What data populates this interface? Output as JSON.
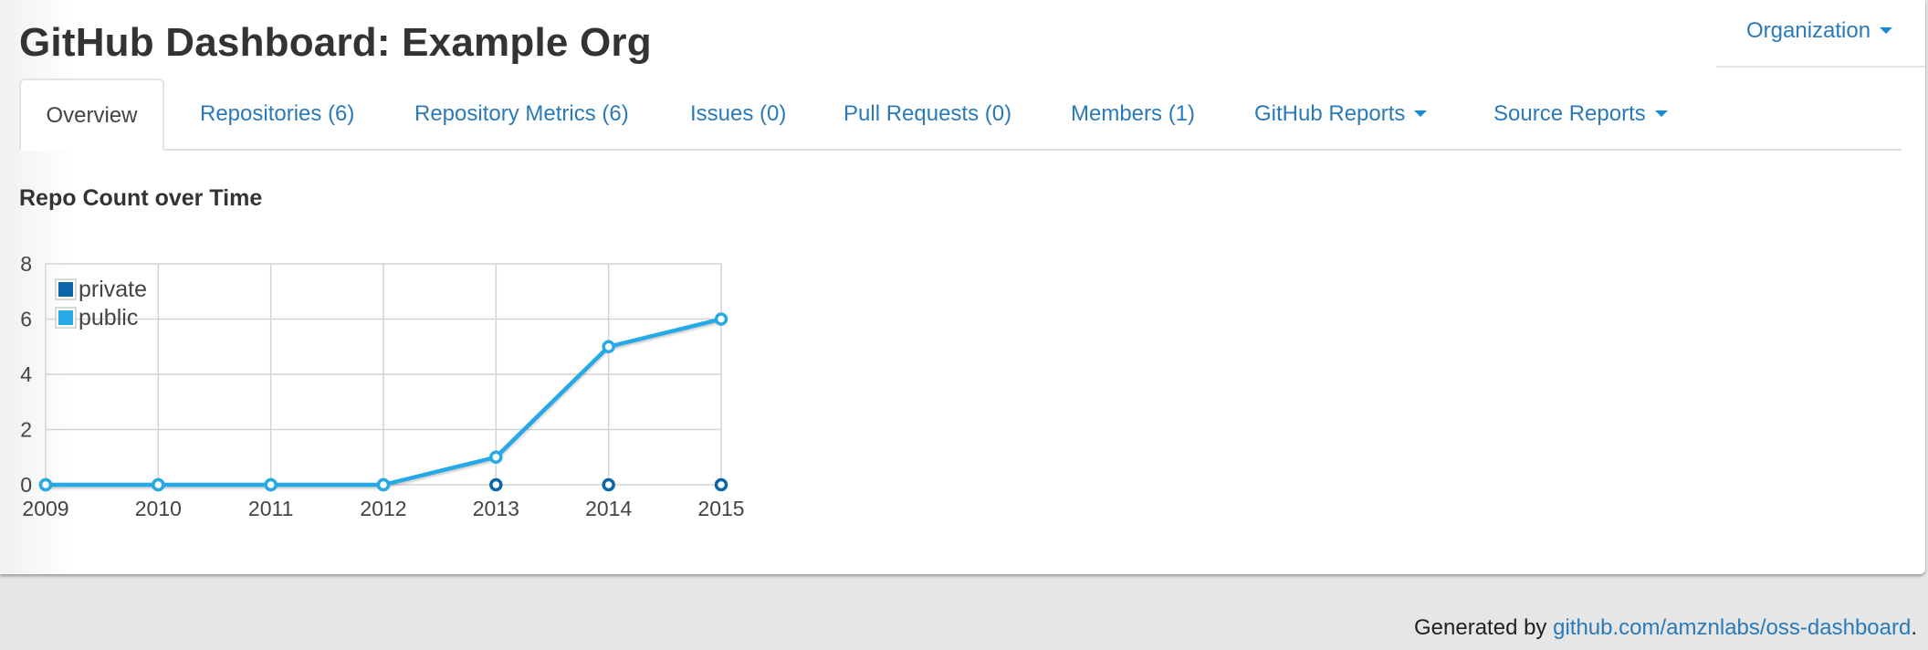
{
  "header": {
    "title": "GitHub Dashboard: Example Org",
    "org_menu_label": "Organization",
    "org_menu_icon": "caret-down-icon"
  },
  "tabs": [
    {
      "label": "Overview",
      "active": true,
      "dropdown": false
    },
    {
      "label": "Repositories (6)",
      "active": false,
      "dropdown": false
    },
    {
      "label": "Repository Metrics (6)",
      "active": false,
      "dropdown": false
    },
    {
      "label": "Issues (0)",
      "active": false,
      "dropdown": false
    },
    {
      "label": "Pull Requests (0)",
      "active": false,
      "dropdown": false
    },
    {
      "label": "Members (1)",
      "active": false,
      "dropdown": false
    },
    {
      "label": "GitHub Reports",
      "active": false,
      "dropdown": true
    },
    {
      "label": "Source Reports",
      "active": false,
      "dropdown": true
    }
  ],
  "colors": {
    "link": "#2a7ab9",
    "private_series": "#0a66a8",
    "public_series": "#27a9e6",
    "grid": "#d4d4d4",
    "footer_bg": "#e6e6e6"
  },
  "section": {
    "title": "Repo Count over Time"
  },
  "chart_data": {
    "type": "line",
    "title": "Repo Count over Time",
    "xlabel": "",
    "ylabel": "",
    "x": [
      "2009",
      "2010",
      "2011",
      "2012",
      "2013",
      "2014",
      "2015"
    ],
    "series": [
      {
        "name": "private",
        "values": [
          0,
          0,
          0,
          0,
          0,
          0,
          0
        ]
      },
      {
        "name": "public",
        "values": [
          0,
          0,
          0,
          0,
          1,
          5,
          6
        ]
      }
    ],
    "ylim": [
      0,
      8
    ],
    "yticks": [
      "0",
      "2",
      "4",
      "6",
      "8"
    ],
    "grid": true,
    "legend_position": "top-left"
  },
  "footer": {
    "prefix": "Generated by ",
    "link_text": "github.com/amznlabs/oss-dashboard",
    "suffix": "."
  }
}
